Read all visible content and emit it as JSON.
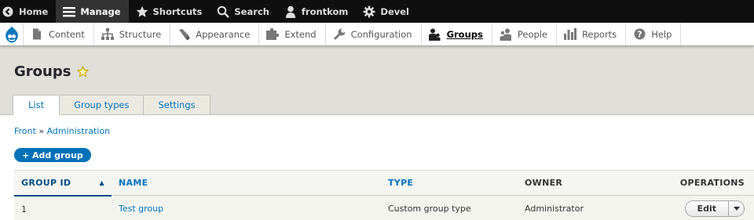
{
  "toolbar": {
    "home": "Home",
    "manage": "Manage",
    "shortcuts": "Shortcuts",
    "search": "Search",
    "user": "frontkom",
    "devel": "Devel"
  },
  "tray": {
    "items": [
      {
        "label": "Content",
        "icon": "file-icon"
      },
      {
        "label": "Structure",
        "icon": "sitemap-icon"
      },
      {
        "label": "Appearance",
        "icon": "brush-icon"
      },
      {
        "label": "Extend",
        "icon": "puzzle-icon"
      },
      {
        "label": "Configuration",
        "icon": "wrench-icon"
      },
      {
        "label": "Groups",
        "icon": "groups-icon"
      },
      {
        "label": "People",
        "icon": "people-icon"
      },
      {
        "label": "Reports",
        "icon": "bar-chart-icon"
      },
      {
        "label": "Help",
        "icon": "help-icon"
      }
    ]
  },
  "page": {
    "title": "Groups"
  },
  "tabs": [
    "List",
    "Group types",
    "Settings"
  ],
  "breadcrumb": {
    "front": "Front",
    "sep": " » ",
    "admin": "Administration"
  },
  "add_button": "+ Add group",
  "table": {
    "headers": [
      "GROUP ID",
      "NAME",
      "TYPE",
      "OWNER",
      "OPERATIONS"
    ],
    "rows": [
      {
        "id": "1",
        "name": "Test group",
        "type": "Custom group type",
        "owner": "Administrator",
        "op": "Edit"
      }
    ]
  },
  "colors": {
    "link": "#0074bd",
    "primary_button": "#0071b8",
    "toolbar": "#0f0f0f"
  }
}
